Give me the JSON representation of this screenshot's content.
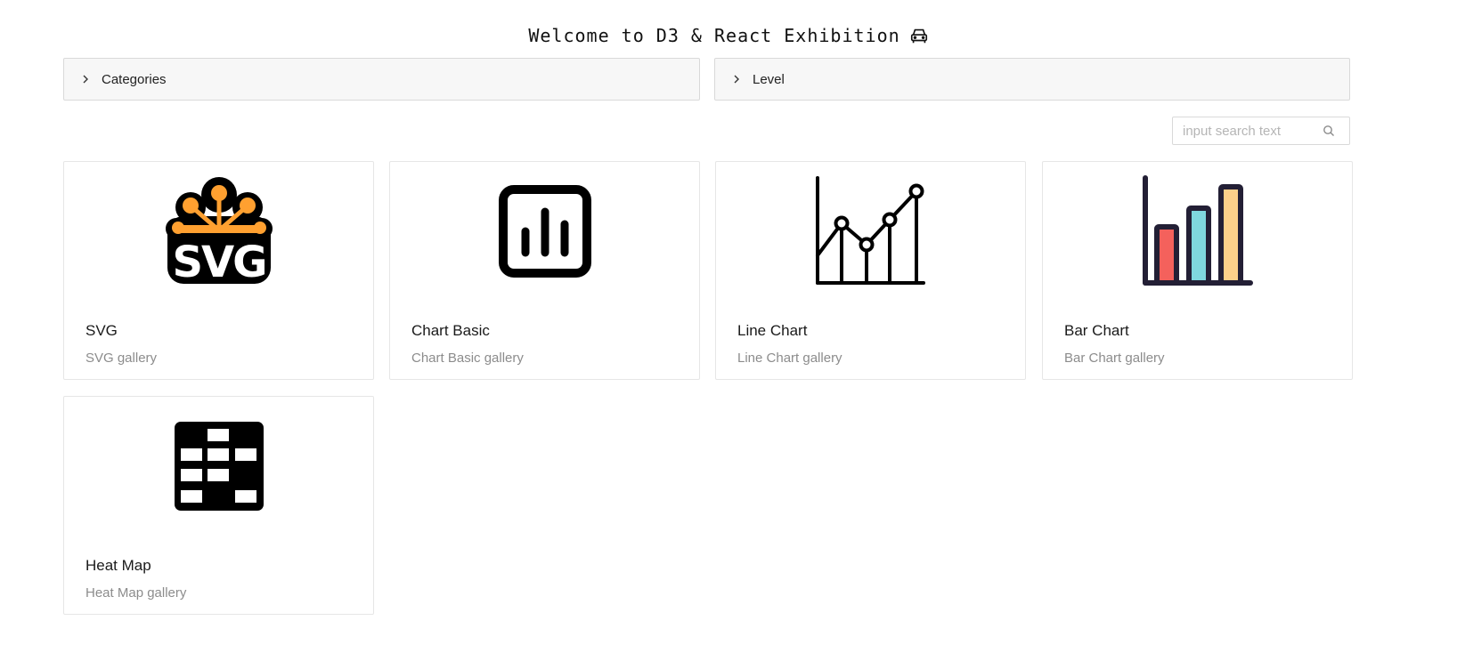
{
  "header": {
    "title": "Welcome to D3 & React Exhibition",
    "title_icon": "car-icon"
  },
  "filters": {
    "categories_label": "Categories",
    "level_label": "Level"
  },
  "search": {
    "placeholder": "input search text",
    "value": "",
    "icon": "search-icon"
  },
  "cards": [
    {
      "title": "SVG",
      "description": "SVG gallery",
      "icon": "svg-logo-icon"
    },
    {
      "title": "Chart Basic",
      "description": "Chart Basic gallery",
      "icon": "chart-basic-icon"
    },
    {
      "title": "Line Chart",
      "description": "Line Chart gallery",
      "icon": "line-chart-icon"
    },
    {
      "title": "Bar Chart",
      "description": "Bar Chart gallery",
      "icon": "bar-chart-icon"
    },
    {
      "title": "Heat Map",
      "description": "Heat Map gallery",
      "icon": "heat-map-icon"
    }
  ],
  "colors": {
    "svg_logo_orange": "#FFA030",
    "bar_red": "#F4615C",
    "bar_cyan": "#7FD8DE",
    "bar_yellow": "#FDD08A",
    "bar_outline": "#231F35"
  }
}
